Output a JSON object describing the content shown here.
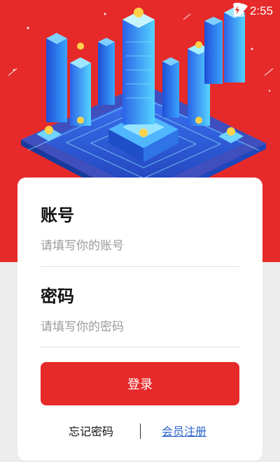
{
  "status_bar": {
    "time": "2:55",
    "icons": [
      "wifi-icon",
      "no-sim-icon",
      "battery-charging-icon"
    ]
  },
  "login": {
    "account": {
      "label": "账号",
      "placeholder": "请填写你的账号",
      "value": ""
    },
    "password": {
      "label": "密码",
      "placeholder": "请填写你的密码",
      "value": ""
    },
    "submit_label": "登录",
    "forgot_password_label": "忘记密码",
    "register_label": "会员注册"
  },
  "colors": {
    "brand_red": "#e62a2a",
    "link_blue": "#2a63c8",
    "page_background": "#ececec"
  }
}
